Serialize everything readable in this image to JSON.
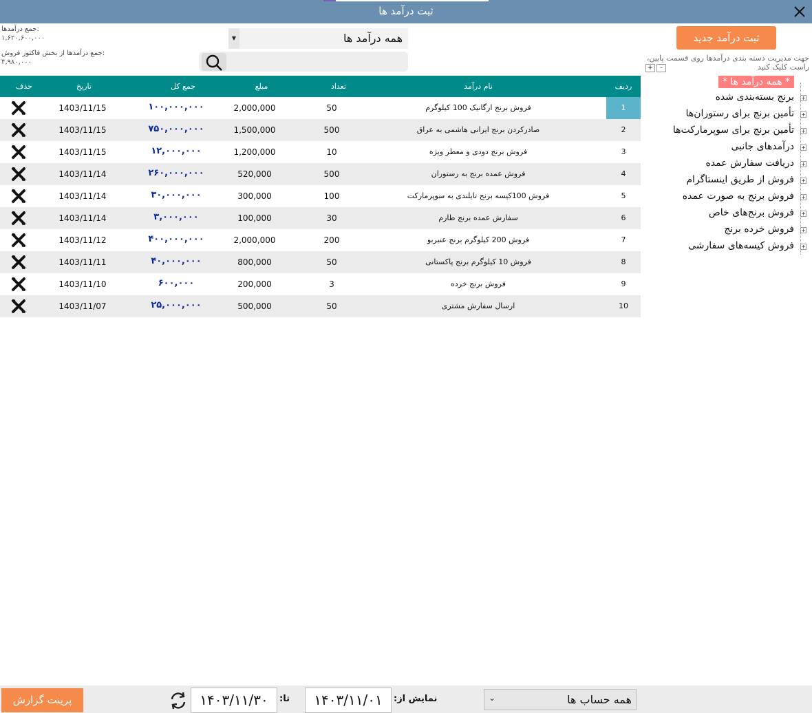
{
  "window": {
    "title": "ثبت درآمد ها"
  },
  "totals": {
    "income_label": "جمع درآمدها:",
    "income_value": "۱,۶۲۰,۶۰۰,۰۰۰",
    "invoice_label": "جمع درآمدها از بخش فاکتور فروش:",
    "invoice_value": "۴,۹۸۰,۰۰۰"
  },
  "filter": {
    "selected": "همه درآمد ها"
  },
  "search": {
    "placeholder": ""
  },
  "new_income_button": "ثبت درآمد جدید",
  "hint_text": "جهت مدیریت دسته بندی درآمدها روی قسمت پایین، راست کلیک کنید",
  "zoom": {
    "plus": "+",
    "minus": "-"
  },
  "table": {
    "headers": {
      "row": "ردیف",
      "name": "نام درآمد",
      "qty": "تعداد",
      "amount": "مبلغ",
      "total": "جمع کل",
      "date": "تاریخ",
      "delete": "حذف"
    },
    "rows": [
      {
        "row": "1",
        "name": "فروش برنج ارگانیک  100 کیلوگرم",
        "qty": "50",
        "amount": "2,000,000",
        "total": "۱۰۰,۰۰۰,۰۰۰",
        "date": "1403/11/15"
      },
      {
        "row": "2",
        "name": "صادرکردن برنج ایرانی هاشمی به عراق",
        "qty": "500",
        "amount": "1,500,000",
        "total": "۷۵۰,۰۰۰,۰۰۰",
        "date": "1403/11/15"
      },
      {
        "row": "3",
        "name": "فروش برنج دودی و معطر ویژه",
        "qty": "10",
        "amount": "1,200,000",
        "total": "۱۲,۰۰۰,۰۰۰",
        "date": "1403/11/15"
      },
      {
        "row": "4",
        "name": "فروش عمده برنج به رستوران",
        "qty": "500",
        "amount": "520,000",
        "total": "۲۶۰,۰۰۰,۰۰۰",
        "date": "1403/11/14"
      },
      {
        "row": "5",
        "name": "فروش 100کیسه برنج تایلندی به سوپرمارکت",
        "qty": "100",
        "amount": "300,000",
        "total": "۳۰,۰۰۰,۰۰۰",
        "date": "1403/11/14"
      },
      {
        "row": "6",
        "name": "سفارش عمده برنج طارم",
        "qty": "30",
        "amount": "100,000",
        "total": "۳,۰۰۰,۰۰۰",
        "date": "1403/11/14"
      },
      {
        "row": "7",
        "name": "فروش 200 کیلوگرم برنج عنبربو",
        "qty": "200",
        "amount": "2,000,000",
        "total": "۴۰۰,۰۰۰,۰۰۰",
        "date": "1403/11/12"
      },
      {
        "row": "8",
        "name": "فروش 10 کیلوگرم برنج پاکستانی",
        "qty": "50",
        "amount": "800,000",
        "total": "۴۰,۰۰۰,۰۰۰",
        "date": "1403/11/11"
      },
      {
        "row": "9",
        "name": "فروش برنج خرده",
        "qty": "3",
        "amount": "200,000",
        "total": "۶۰۰,۰۰۰",
        "date": "1403/11/10"
      },
      {
        "row": "10",
        "name": "ارسال سفارش مشتری",
        "qty": "50",
        "amount": "500,000",
        "total": "۲۵,۰۰۰,۰۰۰",
        "date": "1403/11/07"
      }
    ]
  },
  "tree": {
    "root": "* همه درآمد ها *",
    "items": [
      "برنج بسته‌بندی شده",
      "تأمین برنج برای رستوران‌ها",
      "تأمین برنج برای سوپرمارکت‌ها",
      "درآمدهای جانبی",
      "دریافت سفارش عمده",
      "فروش از طریق اینستاگرام",
      "فروش برنج به صورت عمده",
      "فروش برنج‌های خاص",
      "فروش خرده برنج",
      "فروش کیسه‌های سفارشی"
    ]
  },
  "footer": {
    "print_button": "پرینت گزارش",
    "to_label": "تا:",
    "to_date": "۱۴۰۳/۱۱/۳۰",
    "from_label": "نمایش از:",
    "from_date": "۱۴۰۳/۱۱/۰۱",
    "account_selected": "همه حساب ها"
  },
  "colors": {
    "titlebar": "#6a8fb0",
    "table_header": "#008a8a",
    "accent_button": "#f58a4b",
    "selected_row_cell": "#5ab3c9",
    "total_text": "#0c2b9e",
    "tree_root_bg": "#ff7f7f"
  },
  "icons": {
    "close": "close-icon",
    "search": "search-icon",
    "delete": "delete-x-icon",
    "refresh": "refresh-icon",
    "expand": "plus-box-icon",
    "dropdown": "chevron-down-icon"
  }
}
